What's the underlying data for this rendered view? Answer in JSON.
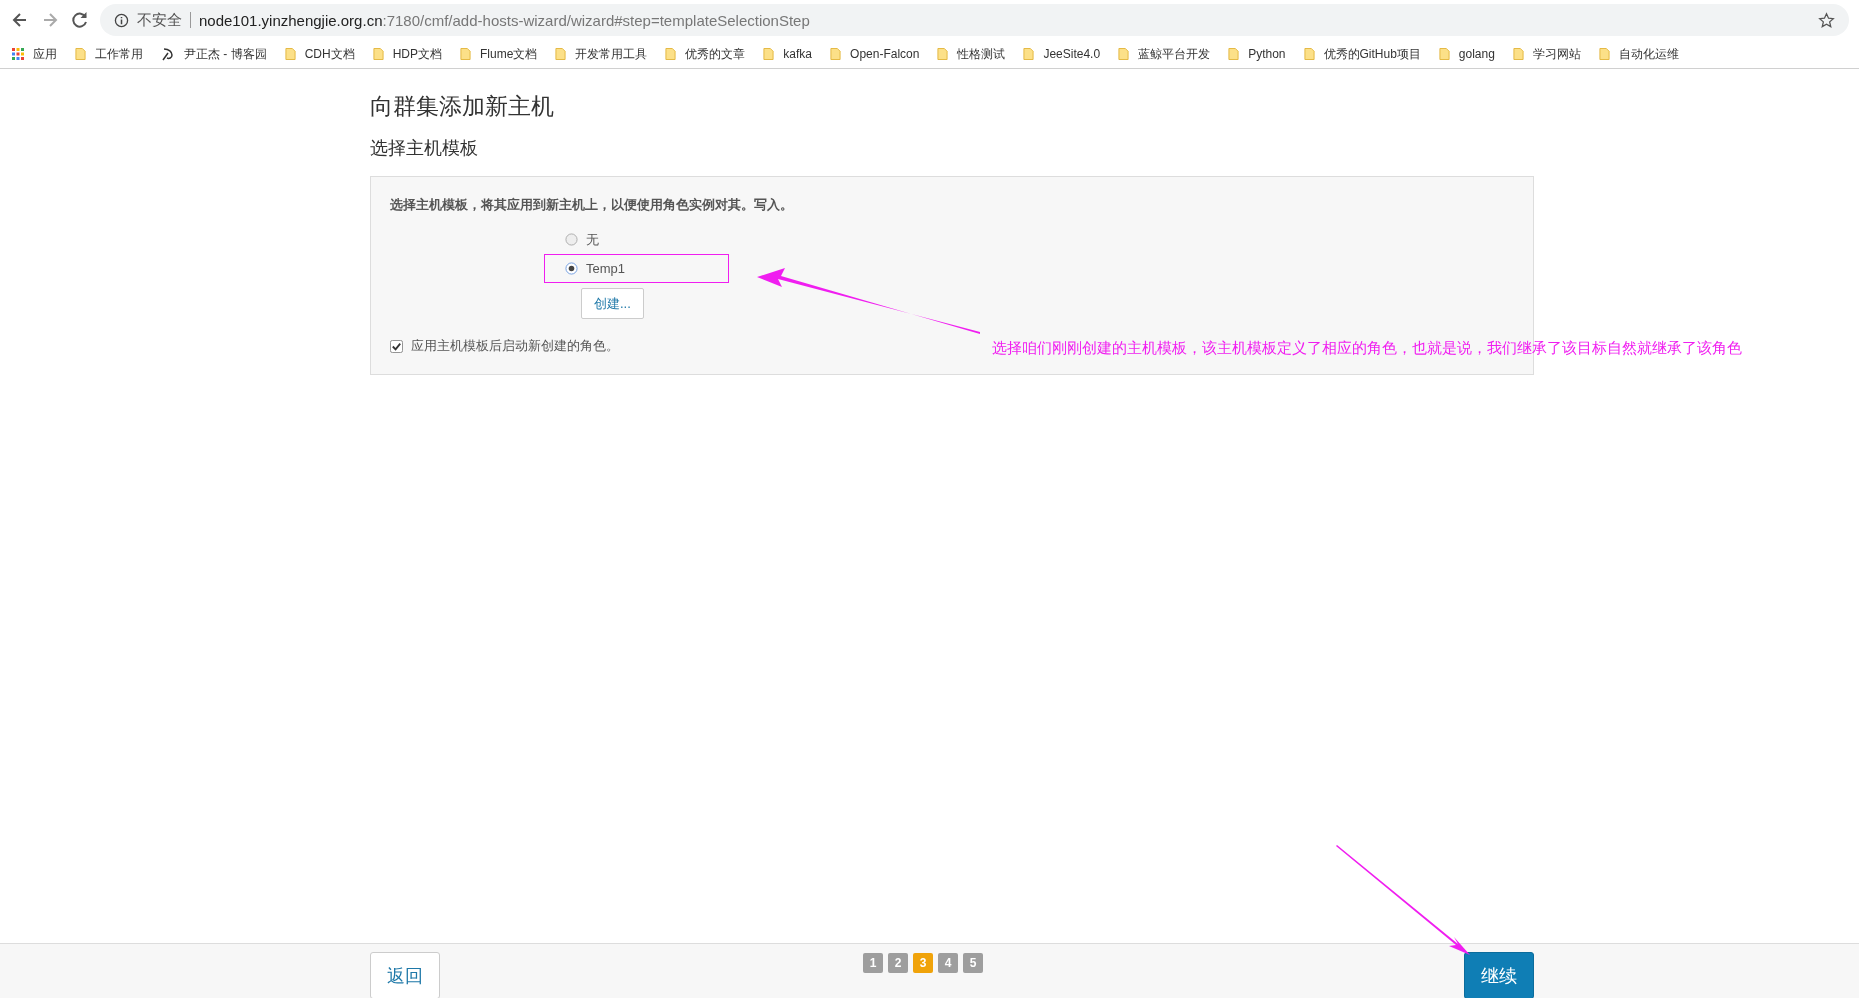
{
  "browser": {
    "security_label": "不安全",
    "url_host": "node101.yinzhengjie.org.cn",
    "url_path": ":7180/cmf/add-hosts-wizard/wizard#step=templateSelectionStep",
    "bookmarks": [
      {
        "kind": "apps",
        "label": "应用"
      },
      {
        "kind": "folder",
        "label": "工作常用"
      },
      {
        "kind": "site",
        "label": "尹正杰 - 博客园"
      },
      {
        "kind": "folder",
        "label": "CDH文档"
      },
      {
        "kind": "folder",
        "label": "HDP文档"
      },
      {
        "kind": "folder",
        "label": "Flume文档"
      },
      {
        "kind": "folder",
        "label": "开发常用工具"
      },
      {
        "kind": "folder",
        "label": "优秀的文章"
      },
      {
        "kind": "folder",
        "label": "kafka"
      },
      {
        "kind": "folder",
        "label": "Open-Falcon"
      },
      {
        "kind": "folder",
        "label": "性格测试"
      },
      {
        "kind": "folder",
        "label": "JeeSite4.0"
      },
      {
        "kind": "folder",
        "label": "蓝鲸平台开发"
      },
      {
        "kind": "folder",
        "label": "Python"
      },
      {
        "kind": "folder",
        "label": "优秀的GitHub项目"
      },
      {
        "kind": "folder",
        "label": "golang"
      },
      {
        "kind": "folder",
        "label": "学习网站"
      },
      {
        "kind": "folder",
        "label": "自动化运维"
      }
    ]
  },
  "page": {
    "title": "向群集添加新主机",
    "subtitle": "选择主机模板",
    "description": "选择主机模板，将其应用到新主机上，以便使用角色实例对其。写入。",
    "templates": [
      {
        "label": "无",
        "selected": false
      },
      {
        "label": "Temp1",
        "selected": true
      }
    ],
    "create_button": "创建...",
    "start_roles": {
      "label": "应用主机模板后启动新创建的角色。",
      "checked": true
    }
  },
  "footer": {
    "back_button": "返回",
    "steps": [
      {
        "label": "1",
        "selected": false
      },
      {
        "label": "2",
        "selected": false
      },
      {
        "label": "3",
        "selected": true
      },
      {
        "label": "4",
        "selected": false
      },
      {
        "label": "5",
        "selected": false
      }
    ],
    "continue_button": "继续"
  },
  "annotation": {
    "text": "选择咱们刚刚创建的主机模板，该主机模板定义了相应的角色，也就是说，我们继承了该目标自然就继承了该角色"
  }
}
